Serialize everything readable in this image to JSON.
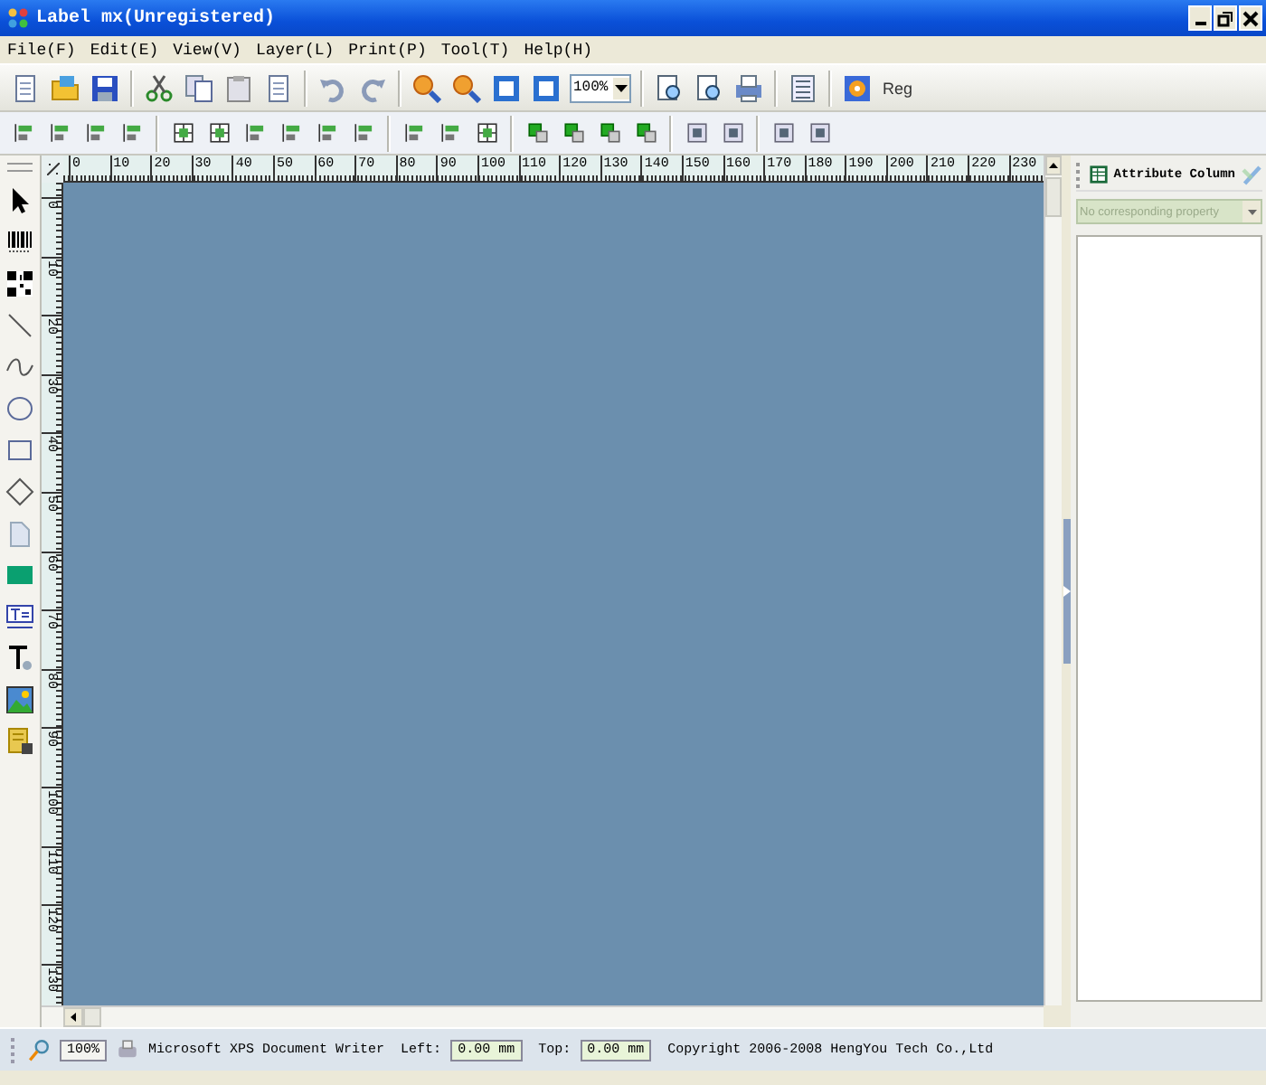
{
  "window": {
    "title": "Label mx(Unregistered)"
  },
  "menu": [
    "File(F)",
    "Edit(E)",
    "View(V)",
    "Layer(L)",
    "Print(P)",
    "Tool(T)",
    "Help(H)"
  ],
  "toolbar": {
    "zoom_combo": "100%",
    "reg_button": "Reg"
  },
  "ruler": {
    "horizontal": [
      "0",
      "10",
      "20",
      "30",
      "40",
      "50",
      "60",
      "70",
      "80",
      "90",
      "100",
      "110",
      "120",
      "130",
      "140",
      "150",
      "160",
      "170",
      "180",
      "190",
      "200",
      "210",
      "220",
      "230"
    ],
    "vertical": [
      "0",
      "10",
      "20",
      "30",
      "40",
      "50",
      "60",
      "70",
      "80",
      "90",
      "100",
      "110",
      "120",
      "130"
    ]
  },
  "attribute_panel": {
    "title": "Attribute Column",
    "property_dropdown": {
      "value": "No corresponding property",
      "disabled": true
    }
  },
  "status_bar": {
    "zoom": "100%",
    "printer": "Microsoft XPS Document Writer",
    "left_label": "Left:",
    "left_value": "0.00 mm",
    "top_label": "Top:",
    "top_value": "0.00 mm",
    "copyright": "Copyright 2006-2008 HengYou Tech Co.,Ltd"
  }
}
